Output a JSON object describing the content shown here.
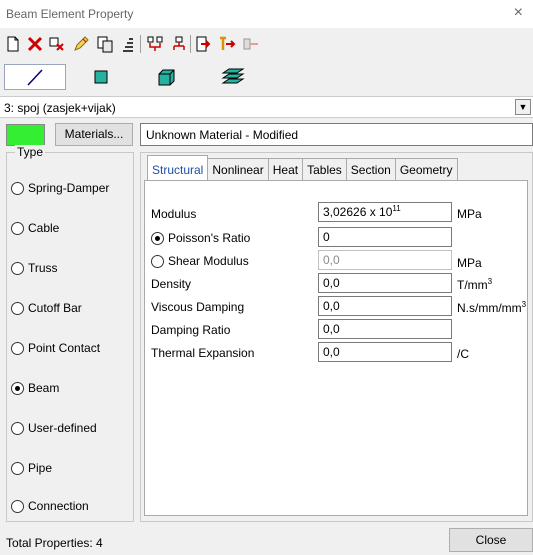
{
  "window": {
    "title": "Beam Element Property",
    "close_glyph": "×"
  },
  "toolbar": {
    "icons": [
      "new-icon",
      "delete-icon",
      "delete-unused-icon",
      "edit-icon",
      "copy-icon",
      "sort-icon",
      "split-icon",
      "merge-icon",
      "import-icon",
      "export-icon",
      "library-icon"
    ]
  },
  "element_types": [
    "line-element-icon",
    "plate-element-icon",
    "brick-element-icon",
    "laminate-element-icon"
  ],
  "property": {
    "selected": "3: spoj (zasjek+vijak)"
  },
  "material": {
    "button_label": "Materials...",
    "name": "Unknown Material - Modified",
    "color": "#33ee33"
  },
  "type_group": {
    "legend": "Type",
    "options": [
      {
        "label": "Spring-Damper",
        "checked": false
      },
      {
        "label": "Cable",
        "checked": false
      },
      {
        "label": "Truss",
        "checked": false
      },
      {
        "label": "Cutoff Bar",
        "checked": false
      },
      {
        "label": "Point Contact",
        "checked": false
      },
      {
        "label": "Beam",
        "checked": true
      },
      {
        "label": "User-defined",
        "checked": false
      },
      {
        "label": "Pipe",
        "checked": false
      },
      {
        "label": "Connection",
        "checked": false
      }
    ]
  },
  "tabs": [
    "Structural",
    "Nonlinear",
    "Heat",
    "Tables",
    "Section",
    "Geometry"
  ],
  "structural": {
    "modulus": {
      "label": "Modulus",
      "value_mantissa": "3,02626 x 10",
      "value_exp": "11",
      "unit": "MPa"
    },
    "poisson": {
      "label": "Poisson's Ratio",
      "value": "0",
      "selected": true
    },
    "shear": {
      "label": "Shear Modulus",
      "value": "0,0",
      "unit": "MPa",
      "selected": false
    },
    "density": {
      "label": "Density",
      "value": "0,0",
      "unit_base": "T/mm",
      "unit_exp": "3"
    },
    "viscous": {
      "label": "Viscous Damping",
      "value": "0,0",
      "unit_base": "N.s/mm/mm",
      "unit_exp": "3"
    },
    "damping_ratio": {
      "label": "Damping Ratio",
      "value": "0,0"
    },
    "thermal": {
      "label": "Thermal Expansion",
      "value": "0,0",
      "unit": "/C"
    }
  },
  "footer": {
    "total": "Total Properties: 4",
    "close_label": "Close"
  }
}
